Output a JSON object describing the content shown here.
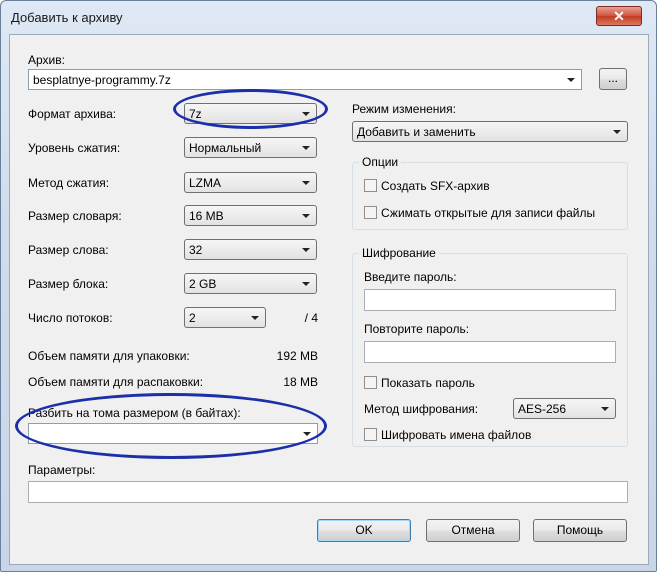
{
  "window": {
    "title": "Добавить к архиву",
    "close_label": "✕"
  },
  "archive": {
    "label": "Архив:",
    "value": "besplatnye-programmy.7z",
    "browse_label": "..."
  },
  "left": {
    "format": {
      "label": "Формат архива:",
      "value": "7z"
    },
    "level": {
      "label": "Уровень сжатия:",
      "value": "Нормальный"
    },
    "method": {
      "label": "Метод сжатия:",
      "value": "LZMA"
    },
    "dict": {
      "label": "Размер словаря:",
      "value": "16 MB"
    },
    "word": {
      "label": "Размер слова:",
      "value": "32"
    },
    "block": {
      "label": "Размер блока:",
      "value": "2 GB"
    },
    "threads": {
      "label": "Число потоков:",
      "value": "2",
      "max": "/ 4"
    },
    "mem_pack": {
      "label": "Объем памяти для упаковки:",
      "value": "192 MB"
    },
    "mem_unpack": {
      "label": "Объем памяти для распаковки:",
      "value": "18 MB"
    },
    "split": {
      "label": "Разбить на тома размером (в байтах):",
      "value": ""
    },
    "params": {
      "label": "Параметры:",
      "value": ""
    }
  },
  "right": {
    "mode": {
      "label": "Режим изменения:",
      "value": "Добавить и заменить"
    },
    "options": {
      "title": "Опции",
      "sfx_label": "Создать SFX-архив",
      "shared_label": "Сжимать открытые для записи файлы"
    },
    "encryption": {
      "title": "Шифрование",
      "password_label": "Введите пароль:",
      "repeat_label": "Повторите пароль:",
      "show_label": "Показать пароль",
      "method_label": "Метод шифрования:",
      "method_value": "AES-256",
      "names_label": "Шифровать имена файлов"
    }
  },
  "buttons": {
    "ok": "OK",
    "cancel": "Отмена",
    "help": "Помощь"
  },
  "colors": {
    "highlight_ellipse": "#1b2fa8"
  }
}
